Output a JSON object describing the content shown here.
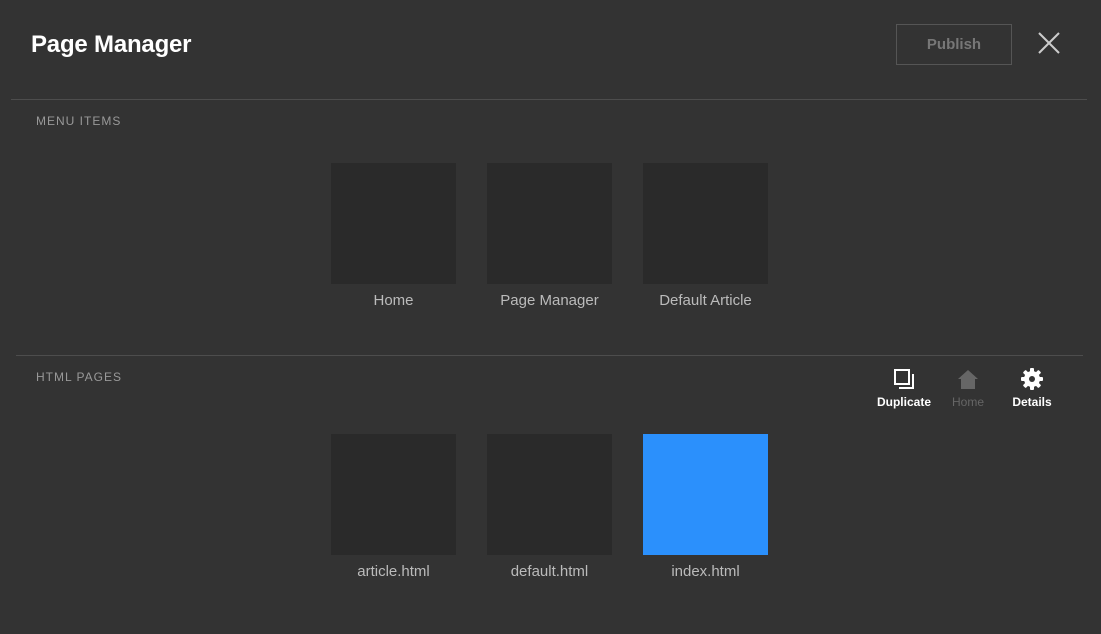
{
  "header": {
    "title": "Page Manager",
    "publish_label": "Publish"
  },
  "sections": {
    "menu_items": {
      "label": "MENU ITEMS",
      "items": [
        {
          "label": "Home"
        },
        {
          "label": "Page Manager"
        },
        {
          "label": "Default Article"
        }
      ]
    },
    "html_pages": {
      "label": "HTML PAGES",
      "items": [
        {
          "label": "article.html"
        },
        {
          "label": "default.html"
        },
        {
          "label": "index.html",
          "selected": true
        }
      ]
    }
  },
  "toolbar": {
    "duplicate_label": "Duplicate",
    "home_label": "Home",
    "details_label": "Details"
  },
  "colors": {
    "background": "#333333",
    "thumbnail": "#2a2a2a",
    "selected": "#2b90fc"
  },
  "icons": {
    "close": "close-icon",
    "duplicate": "duplicate-icon",
    "home": "home-icon",
    "details": "gear-icon"
  }
}
